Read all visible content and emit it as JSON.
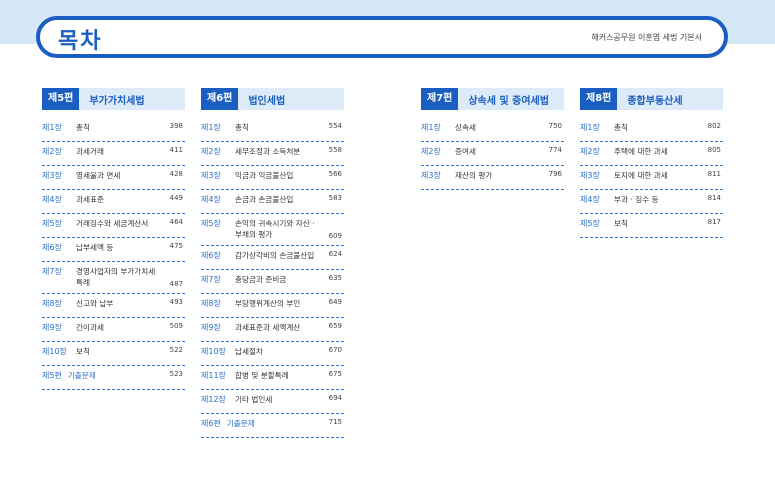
{
  "header": {
    "title": "목차",
    "subtitle": "해커스공무원 이훈엽 세법 기본서"
  },
  "parts": [
    {
      "badge": "제5편",
      "title": "부가가치세법",
      "chapters": [
        {
          "ch": "제1장",
          "name": "총칙",
          "page": "398"
        },
        {
          "ch": "제2장",
          "name": "과세거래",
          "page": "411"
        },
        {
          "ch": "제3장",
          "name": "영세율과 면세",
          "page": "428"
        },
        {
          "ch": "제4장",
          "name": "과세표준",
          "page": "449"
        },
        {
          "ch": "제5장",
          "name": "거래징수와 세금계산서",
          "page": "464"
        },
        {
          "ch": "제6장",
          "name": "납부세액 등",
          "page": "475"
        },
        {
          "ch": "제7장",
          "name": "경영사업자의 부가가치세",
          "name2": "특례",
          "page": "487"
        },
        {
          "ch": "제8장",
          "name": "신고와 납부",
          "page": "493"
        },
        {
          "ch": "제9장",
          "name": "간이과세",
          "page": "509"
        },
        {
          "ch": "제10장",
          "name": "보칙",
          "page": "522"
        },
        {
          "ch": "제5편",
          "name": "기출문제",
          "page": "523",
          "exam": true
        }
      ]
    },
    {
      "badge": "제6편",
      "title": "법인세법",
      "chapters": [
        {
          "ch": "제1장",
          "name": "총칙",
          "page": "554"
        },
        {
          "ch": "제2장",
          "name": "세무조정과 소득처분",
          "page": "558"
        },
        {
          "ch": "제3장",
          "name": "익금과 익금불산입",
          "page": "566"
        },
        {
          "ch": "제4장",
          "name": "손금과 손금불산입",
          "page": "583"
        },
        {
          "ch": "제5장",
          "name": "손익의 귀속시기와 자산 ·",
          "name2": "부채의 평가",
          "page": "609"
        },
        {
          "ch": "제6장",
          "name": "감가상각비의 손금불산입",
          "page": "624"
        },
        {
          "ch": "제7장",
          "name": "충당금과 준비금",
          "page": "635"
        },
        {
          "ch": "제8장",
          "name": "부당행위계산의 부인",
          "page": "649"
        },
        {
          "ch": "제9장",
          "name": "과세표준과 세액계산",
          "page": "659"
        },
        {
          "ch": "제10장",
          "name": "납세절차",
          "page": "670"
        },
        {
          "ch": "제11장",
          "name": "합병 및 분할특례",
          "page": "675"
        },
        {
          "ch": "제12장",
          "name": "기타 법인세",
          "page": "694"
        },
        {
          "ch": "제6편",
          "name": "기출문제",
          "page": "715",
          "exam": true
        }
      ]
    },
    {
      "badge": "제7편",
      "title": "상속세 및 증여세법",
      "chapters": [
        {
          "ch": "제1장",
          "name": "상속세",
          "page": "750"
        },
        {
          "ch": "제2장",
          "name": "증여세",
          "page": "774"
        },
        {
          "ch": "제3장",
          "name": "재산의 평가",
          "page": "796"
        }
      ]
    },
    {
      "badge": "제8편",
      "title": "종합부동산세",
      "chapters": [
        {
          "ch": "제1장",
          "name": "총칙",
          "page": "802"
        },
        {
          "ch": "제2장",
          "name": "주택에 대한 과세",
          "page": "805"
        },
        {
          "ch": "제3장",
          "name": "토지에 대한 과세",
          "page": "811"
        },
        {
          "ch": "제4장",
          "name": "부과 · 징수 등",
          "page": "814"
        },
        {
          "ch": "제5장",
          "name": "보칙",
          "page": "817"
        }
      ]
    }
  ],
  "colors": {
    "accent": "#1a5ec2",
    "band": "#d6e8f8",
    "part_bg": "#ddeaf8",
    "chapter_text": "#2a6fcf"
  }
}
